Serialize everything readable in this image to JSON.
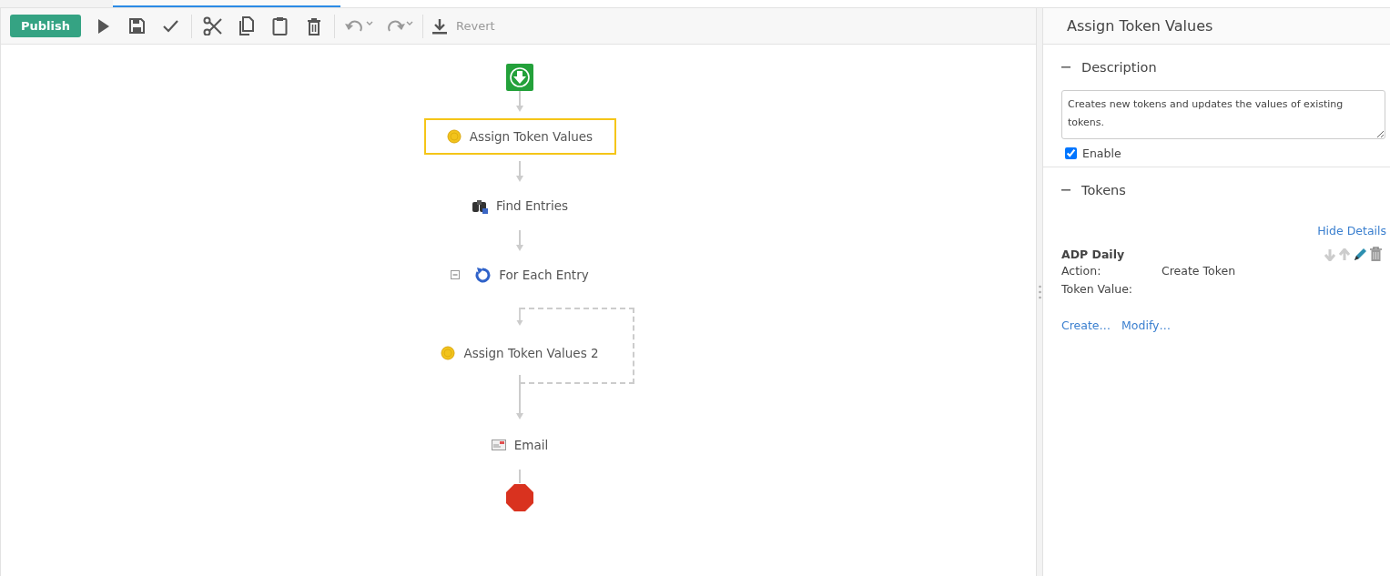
{
  "toolbar": {
    "items": [
      {
        "kind": "primary",
        "label": "Publish",
        "disabled": false
      },
      {
        "kind": "play",
        "disabled": false
      },
      {
        "kind": "save",
        "disabled": false
      },
      {
        "kind": "check",
        "disabled": false
      },
      {
        "kind": "separator"
      },
      {
        "kind": "cut",
        "disabled": false
      },
      {
        "kind": "copy",
        "disabled": false
      },
      {
        "kind": "paste",
        "disabled": false
      },
      {
        "kind": "delete",
        "disabled": false
      },
      {
        "kind": "separator"
      },
      {
        "kind": "undo",
        "disabled": true
      },
      {
        "kind": "redo",
        "disabled": true
      },
      {
        "kind": "separator"
      },
      {
        "kind": "revert",
        "label": "Revert",
        "disabled": true
      }
    ]
  },
  "workflow": {
    "nodes": [
      {
        "kind": "start"
      },
      {
        "kind": "assign",
        "label": "Assign Token Values",
        "selected": true
      },
      {
        "kind": "find",
        "label": "Find Entries",
        "selected": false
      },
      {
        "kind": "foreach",
        "label": "For Each Entry",
        "selected": false,
        "expanded": true,
        "children": [
          {
            "kind": "assign",
            "label": "Assign Token Values 2",
            "selected": false
          }
        ]
      },
      {
        "kind": "email",
        "label": "Email",
        "selected": false
      },
      {
        "kind": "stop"
      }
    ]
  },
  "panel": {
    "title": "Assign Token Values",
    "sections": [
      {
        "kind": "description",
        "title": "Description",
        "expanded": true,
        "text": "Creates new tokens and updates the values of existing tokens.",
        "enable": {
          "label": "Enable",
          "checked": true
        }
      },
      {
        "kind": "tokens",
        "title": "Tokens",
        "expanded": true,
        "details_link": "Hide Details",
        "tokens": [
          {
            "name": "ADP Daily",
            "fields": [
              {
                "label": "Action:",
                "value": "Create Token"
              },
              {
                "label": "Token Value:"
              }
            ]
          }
        ],
        "links": [
          "Create…",
          "Modify…"
        ]
      }
    ]
  }
}
